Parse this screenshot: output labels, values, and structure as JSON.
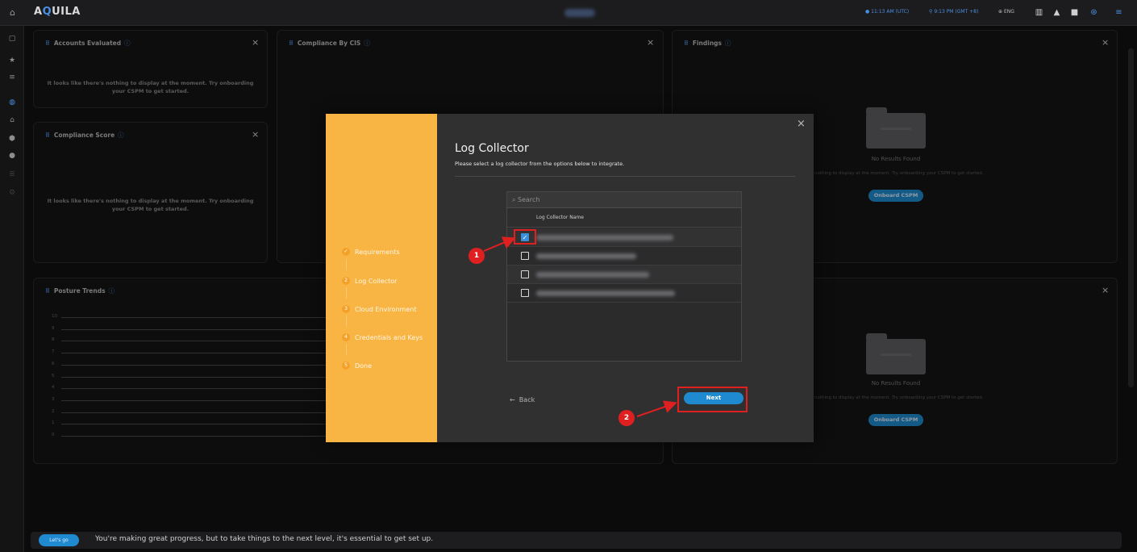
{
  "app": {
    "brand_prefix": "A",
    "brand_accent": "Q",
    "brand_suffix": "UILA"
  },
  "topbar": {
    "utc_time": "11:13 AM (UTC)",
    "local_time": "9:13 PM (GMT +8)",
    "language": "ENG",
    "icons": [
      "home-icon",
      "globe-icon",
      "building-icon",
      "bell-icon",
      "book-icon",
      "support-icon",
      "menu-icon"
    ]
  },
  "sidebar": {
    "icons": [
      "panel-icon",
      "star-icon",
      "list-icon",
      "dashboard-icon",
      "bank-icon",
      "shield-icon",
      "cloud-icon",
      "database-icon",
      "settings-icon"
    ]
  },
  "cards": {
    "accounts": {
      "title": "Accounts Evaluated",
      "close": "×",
      "empty": "It looks like there's nothing to display at the moment. Try onboarding your CSPM to get started."
    },
    "cis": {
      "title": "Compliance By CIS",
      "close": "×"
    },
    "findings": {
      "title": "Findings",
      "close": "×",
      "no_results": "No Results Found",
      "nothing": "nothing to display at the moment. Try onboarding your CSPM to get started.",
      "button": "Onboard CSPM"
    },
    "score": {
      "title": "Compliance Score",
      "close": "×",
      "empty": "It looks like there's nothing to display at the moment. Try onboarding your CSPM to get started."
    },
    "trends": {
      "title": "Posture Trends",
      "close": "×",
      "y_ticks": [
        "10",
        "9",
        "8",
        "7",
        "6",
        "5",
        "4",
        "3",
        "2",
        "1",
        "0"
      ]
    },
    "right2": {
      "close": "×",
      "no_results": "No Results Found",
      "nothing": "nothing to display at the moment. Try onboarding your CSPM to get started.",
      "button": "Onboard CSPM"
    }
  },
  "modal": {
    "title": "Log Collector",
    "subtitle": "Please select a log collector from the options below to integrate.",
    "close": "×",
    "steps": [
      {
        "num": "",
        "label": "Requirements",
        "done": true
      },
      {
        "num": "2",
        "label": "Log Collector"
      },
      {
        "num": "3",
        "label": "Cloud Environment"
      },
      {
        "num": "4",
        "label": "Credentials and Keys"
      },
      {
        "num": "5",
        "label": "Done"
      }
    ],
    "search_placeholder": "Search",
    "column_header": "Log Collector Name",
    "rows": [
      {
        "checked": true
      },
      {
        "checked": false
      },
      {
        "checked": false
      },
      {
        "checked": false
      }
    ],
    "back_label": "Back",
    "next_label": "Next"
  },
  "annotations": {
    "badge1": "1",
    "badge2": "2"
  },
  "bottom": {
    "button": "Let's go",
    "message": "You're making great progress, but to take things to the next level, it's essential to get set up."
  },
  "colors": {
    "accent": "#1f8ad0",
    "step_panel": "#f9b544",
    "highlight": "#e02020"
  }
}
